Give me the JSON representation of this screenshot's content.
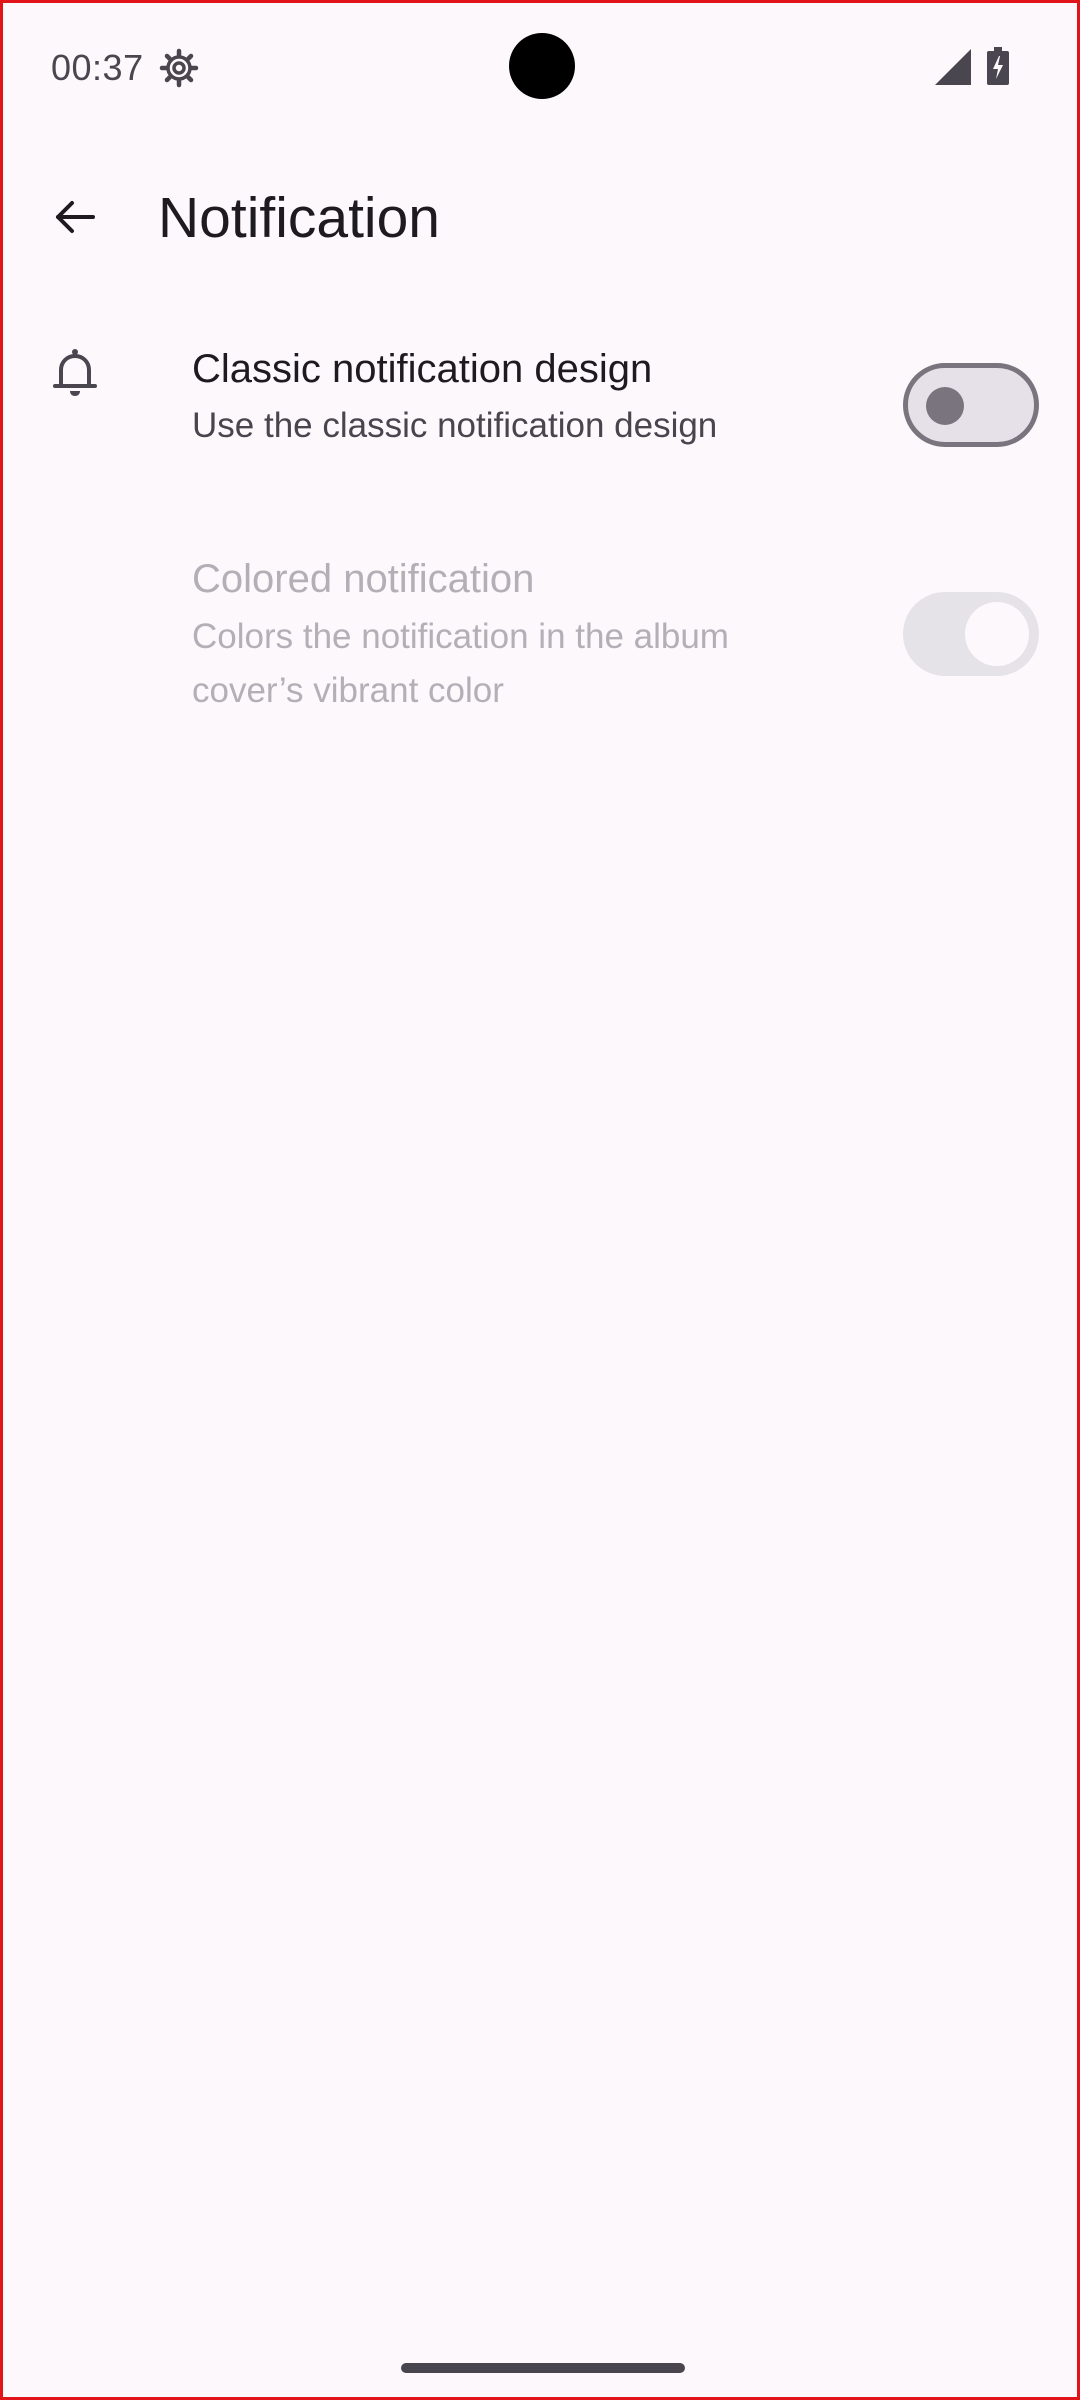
{
  "status_bar": {
    "time": "00:37",
    "icons": [
      "gear-icon",
      "signal-icon",
      "battery-charging-icon"
    ]
  },
  "app_bar": {
    "title": "Notification",
    "back_icon": "arrow-back-icon"
  },
  "preferences": [
    {
      "icon": "bell-icon",
      "title": "Classic notification design",
      "summary": "Use the classic notification design",
      "checked": false,
      "enabled": true
    },
    {
      "title": "Colored notification",
      "summary": "Colors the notification in the album cover’s vibrant color",
      "checked": true,
      "enabled": false
    }
  ],
  "colors": {
    "background": "#fdf8fc",
    "text_primary": "#1d1b20",
    "text_secondary": "#49454f",
    "text_disabled": "#b3afb6",
    "switch_outline": "#79747e",
    "frame_border": "#e2141b"
  }
}
